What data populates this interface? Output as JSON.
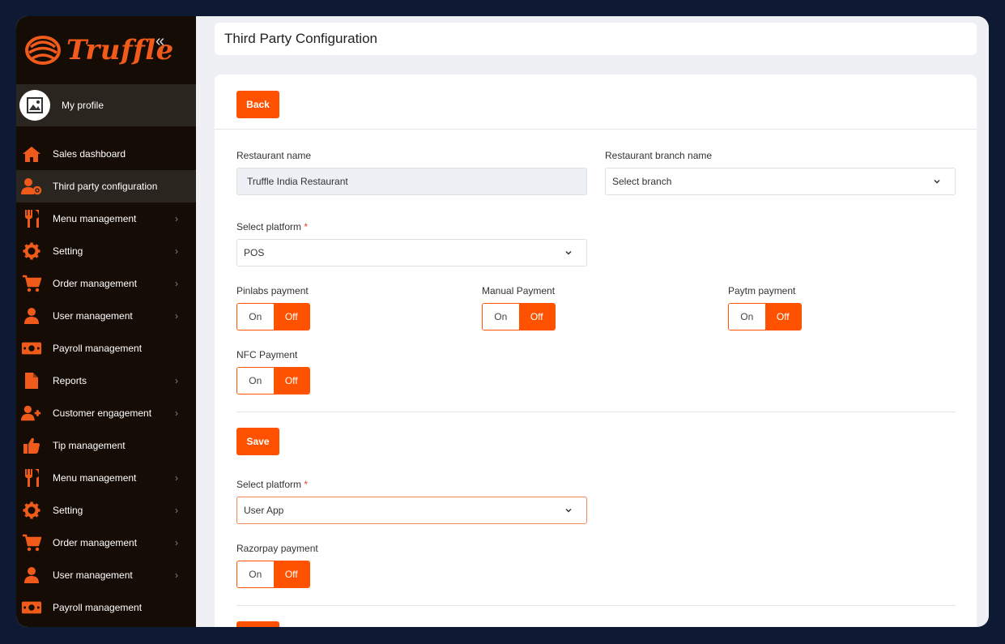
{
  "app": {
    "name": "Truffle"
  },
  "profile": {
    "label": "My profile"
  },
  "nav": [
    {
      "label": "Sales dashboard",
      "icon": "home-icon",
      "chevron": false,
      "active": false
    },
    {
      "label": "Third party configuration",
      "icon": "user-gear-icon",
      "chevron": false,
      "active": true
    },
    {
      "label": "Menu management",
      "icon": "utensils-icon",
      "chevron": true,
      "active": false
    },
    {
      "label": "Setting",
      "icon": "gear-icon",
      "chevron": true,
      "active": false
    },
    {
      "label": "Order management",
      "icon": "cart-icon",
      "chevron": true,
      "active": false
    },
    {
      "label": "User management",
      "icon": "user-icon",
      "chevron": true,
      "active": false
    },
    {
      "label": "Payroll management",
      "icon": "money-icon",
      "chevron": false,
      "active": false
    },
    {
      "label": "Reports",
      "icon": "file-icon",
      "chevron": true,
      "active": false
    },
    {
      "label": "Customer engagement",
      "icon": "user-plus-icon",
      "chevron": true,
      "active": false
    },
    {
      "label": "Tip management",
      "icon": "thumbs-up-icon",
      "chevron": false,
      "active": false
    },
    {
      "label": "Menu management",
      "icon": "utensils-icon",
      "chevron": true,
      "active": false
    },
    {
      "label": "Setting",
      "icon": "gear-icon",
      "chevron": true,
      "active": false
    },
    {
      "label": "Order management",
      "icon": "cart-icon",
      "chevron": true,
      "active": false
    },
    {
      "label": "User management",
      "icon": "user-icon",
      "chevron": true,
      "active": false
    },
    {
      "label": "Payroll management",
      "icon": "money-icon",
      "chevron": false,
      "active": false
    }
  ],
  "header": {
    "title": "Third Party Configuration"
  },
  "form": {
    "back_label": "Back",
    "restaurant_name_label": "Restaurant name",
    "restaurant_name_value": "Truffle India Restaurant",
    "branch_label": "Restaurant branch name",
    "branch_value": "Select branch",
    "platform_label": "Select platform",
    "required_mark": "*",
    "platform1_value": "POS",
    "toggles1": [
      {
        "label": "Pinlabs payment",
        "on": "On",
        "off": "Off"
      },
      {
        "label": "Manual Payment",
        "on": "On",
        "off": "Off"
      },
      {
        "label": "Paytm payment",
        "on": "On",
        "off": "Off"
      },
      {
        "label": "NFC Payment",
        "on": "On",
        "off": "Off"
      }
    ],
    "save_label": "Save",
    "platform2_value": "User App",
    "toggles2": [
      {
        "label": "Razorpay payment",
        "on": "On",
        "off": "Off"
      }
    ]
  },
  "colors": {
    "accent": "#ff5200",
    "sidebar": "#150c06",
    "sidebar_active": "#2b2520"
  }
}
